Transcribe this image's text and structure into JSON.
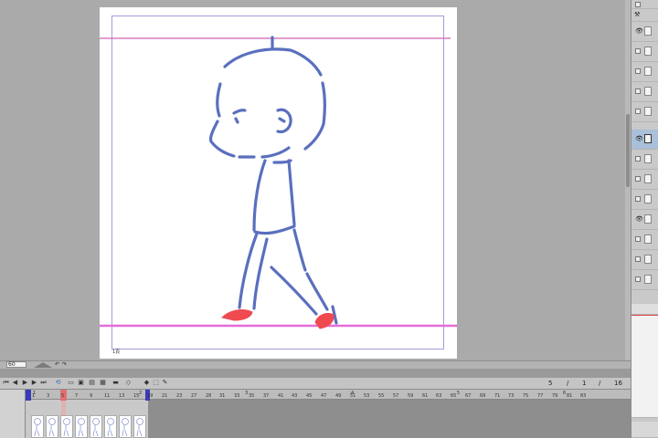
{
  "canvas": {
    "page_label": "1頁",
    "zoom_value": "60"
  },
  "colors": {
    "workspace": "#aaaaaa",
    "paper": "#ffffff",
    "guide_line": "#e060c0",
    "frame_border": "#9f9fd6",
    "character_stroke": "#5a6fbe",
    "shoe_fill": "#ef4a50",
    "playhead": "#e07070",
    "range_marker": "#3a3ab8"
  },
  "timeline": {
    "current_frame": "5",
    "separator_a": "/",
    "total_a": "1",
    "separator_b": "/",
    "total_b": "16",
    "ruler_labels": [
      "1",
      "3",
      "5",
      "7",
      "9",
      "11",
      "13",
      "15",
      "19",
      "21",
      "23",
      "27",
      "28",
      "31",
      "33",
      "35",
      "37",
      "41",
      "43",
      "45",
      "47",
      "49",
      "51",
      "53",
      "55",
      "57",
      "59",
      "61",
      "63",
      "65",
      "67",
      "69",
      "71",
      "73",
      "75",
      "77",
      "79",
      "81",
      "83"
    ],
    "second_markers": [
      "1",
      "2",
      "3",
      "4",
      "5",
      "6"
    ]
  },
  "icons": {
    "first_frame": "skip-start-icon",
    "prev_frame": "step-back-icon",
    "play": "play-icon",
    "next_frame": "step-forward-icon",
    "last_frame": "skip-end-icon",
    "loop": "loop-icon",
    "visibility": "eye-icon"
  }
}
